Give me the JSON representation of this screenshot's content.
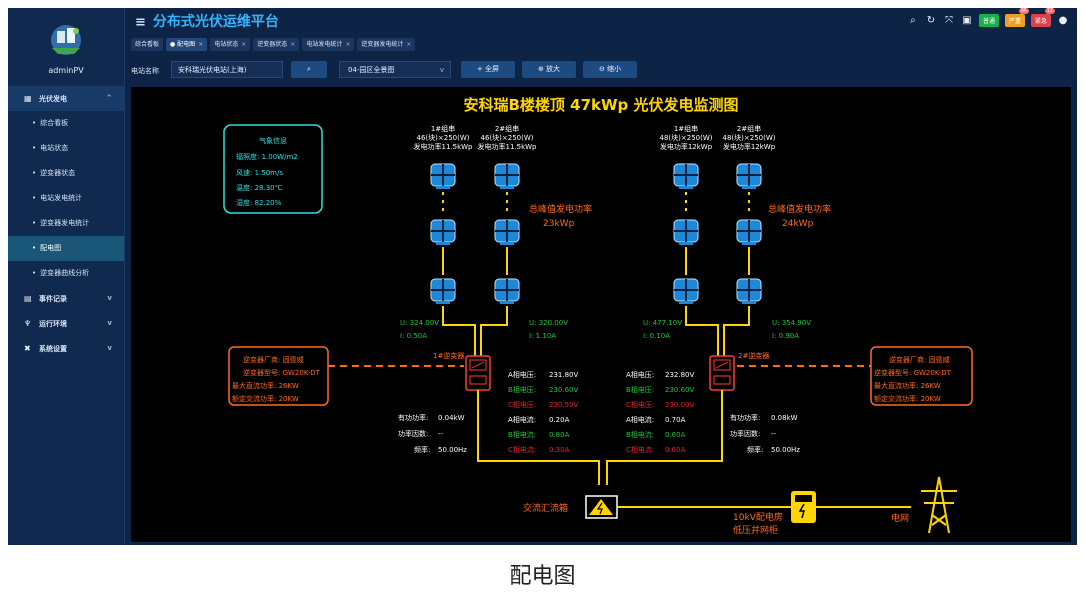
{
  "app": {
    "title": "分布式光伏运维平台",
    "user": "adminPV",
    "caption": "配电图"
  },
  "topbar": {
    "badges": [
      {
        "label": "普通",
        "color": "#18b04a",
        "count": ""
      },
      {
        "label": "严重",
        "color": "#f0a020",
        "count": "96"
      },
      {
        "label": "紧急",
        "color": "#e0404a",
        "count": "12"
      }
    ]
  },
  "sidebar": {
    "group_pv": "光伏发电",
    "items": [
      "综合看板",
      "电站状态",
      "逆变器状态",
      "电站发电统计",
      "逆变器发电统计",
      "配电图",
      "逆变器曲线分析"
    ],
    "groups": [
      "事件记录",
      "运行环境",
      "系统设置"
    ]
  },
  "tabs": [
    "综合看板",
    "配电图",
    "电站状态",
    "逆变器状态",
    "电站发电统计",
    "逆变器发电统计"
  ],
  "toolbar": {
    "station_label": "电站名称",
    "station_value": "安科瑞光伏电站(上海)",
    "area_value": "04-园区全景图",
    "fullscreen": "全屏",
    "zoom_in": "放大",
    "zoom_out": "缩小"
  },
  "diagram": {
    "title": "安科瑞B楼楼顶 47kWp 光伏发电监测图",
    "weather": {
      "title": "气象信息",
      "irradiance": "辐照度:   1.00W/m2",
      "wind": "风速:   1.50m/s",
      "temp": "温度:   28.30℃",
      "humidity": "湿度:   82.20%"
    },
    "strings": [
      {
        "name": "1#组串",
        "spec": "46(块)×250(W)",
        "power": "发电功率11.5kWp"
      },
      {
        "name": "2#组串",
        "spec": "46(块)×250(W)",
        "power": "发电功率11.5kWp"
      },
      {
        "name": "1#组串",
        "spec": "48(块)×250(W)",
        "power": "发电功率12kWp"
      },
      {
        "name": "2#组串",
        "spec": "48(块)×250(W)",
        "power": "发电功率12kWp"
      }
    ],
    "peak": [
      {
        "label": "总峰值发电功率",
        "value": "23kWp"
      },
      {
        "label": "总峰值发电功率",
        "value": "24kWp"
      }
    ],
    "dc": [
      {
        "u": "U:  324.00V",
        "i": "I:  0.50A"
      },
      {
        "u": "U:  320.00V",
        "i": "I:  1.10A"
      },
      {
        "u": "U:  477.10V",
        "i": "I:  0.10A"
      },
      {
        "u": "U:  354.90V",
        "i": "I:  0.90A"
      }
    ],
    "inverters": [
      {
        "name": "1#逆变器",
        "maker": "逆变器厂商:  固德威",
        "model": "逆变器型号:  GW20K-DT",
        "max_dc": "最大直流功率:  26KW",
        "rated_ac": "额定交流功率:  20KW",
        "active": "有功功率:",
        "active_v": "0.04kW",
        "pf": "功率因数:",
        "pf_v": "--",
        "freq": "频率:",
        "freq_v": "50.00Hz",
        "phase": [
          [
            "A相电压:",
            "231.80V"
          ],
          [
            "B相电压:",
            "230.60V"
          ],
          [
            "C相电压:",
            "230.50V"
          ],
          [
            "A相电流:",
            "0.20A"
          ],
          [
            "B相电流:",
            "0.80A"
          ],
          [
            "C相电流:",
            "0.30A"
          ]
        ]
      },
      {
        "name": "2#逆变器",
        "maker": "逆变器厂商:  固德威",
        "model": "逆变器型号:  GW20K-DT",
        "max_dc": "最大直流功率:  26KW",
        "rated_ac": "额定交流功率:  20KW",
        "active": "有功功率:",
        "active_v": "0.08kW",
        "pf": "功率因数:",
        "pf_v": "--",
        "freq": "频率:",
        "freq_v": "50.00Hz",
        "phase": [
          [
            "A相电压:",
            "232.80V"
          ],
          [
            "B相电压:",
            "230.60V"
          ],
          [
            "C相电压:",
            "230.00V"
          ],
          [
            "A相电流:",
            "0.70A"
          ],
          [
            "B相电流:",
            "0.60A"
          ],
          [
            "C相电流:",
            "0.60A"
          ]
        ]
      }
    ],
    "combiner": "交流汇流箱",
    "room": [
      "10kV配电房",
      "低压并网柜"
    ],
    "grid": "电网"
  }
}
